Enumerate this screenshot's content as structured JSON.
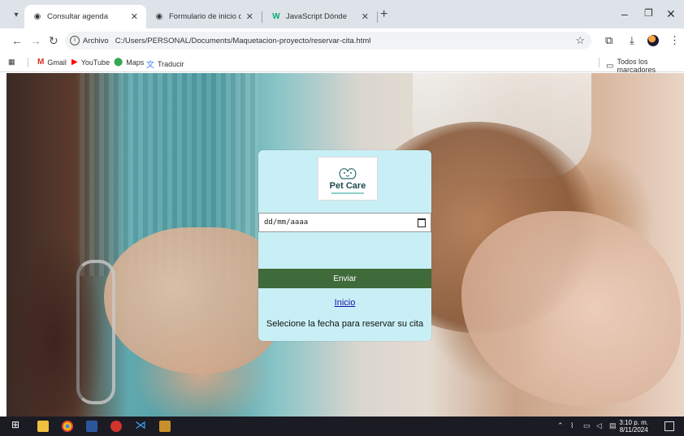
{
  "tabs": [
    {
      "title": "Consultar agenda",
      "active": true,
      "favicon": "globe-icon"
    },
    {
      "title": "Formulario de inicio de sesion",
      "active": false,
      "favicon": "globe-icon"
    },
    {
      "title": "JavaScript Dónde",
      "active": false,
      "favicon": "w3schools-icon"
    }
  ],
  "toolbar": {
    "security_chip": "Archivo",
    "url": "C:/Users/PERSONAL/Documents/Maquetacion-proyecto/reservar-cita.html"
  },
  "bookmarks": {
    "items": [
      {
        "label": "Gmail",
        "icon": "gmail-icon"
      },
      {
        "label": "YouTube",
        "icon": "youtube-icon"
      },
      {
        "label": "Maps",
        "icon": "maps-icon"
      },
      {
        "label": "Traducir",
        "icon": "translate-icon"
      }
    ],
    "all_bookmarks": "Todos los marcadores"
  },
  "form": {
    "logo_text": "Pet Care",
    "date_placeholder": "dd/mm/aaaa",
    "submit_label": "Enviar",
    "home_link": "Inicio",
    "instructions": "Selecione la fecha para reservar su cita"
  },
  "taskbar": {
    "time": "3:10 p. m.",
    "date": "8/11/2024"
  },
  "colors": {
    "card_bg": "#c8eff5",
    "submit_bg": "#3f6b3a",
    "link": "#1a0dab"
  }
}
